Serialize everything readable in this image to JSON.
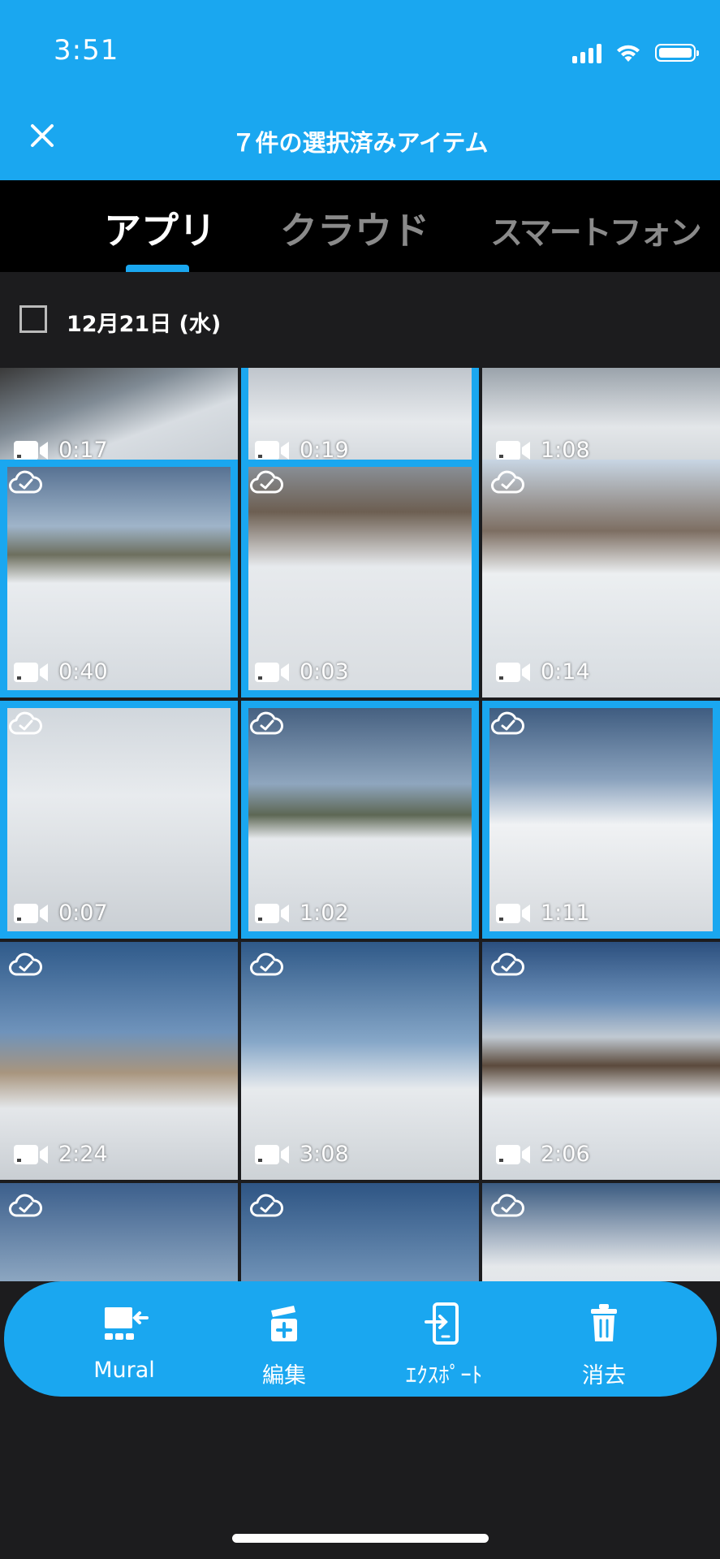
{
  "status_bar": {
    "time": "3:51"
  },
  "header": {
    "title": "７件の選択済みアイテム",
    "close_icon": "close-icon"
  },
  "tabs": [
    {
      "label": "アプリ",
      "active": true
    },
    {
      "label": "クラウド",
      "active": false
    },
    {
      "label": "スマートフォン",
      "active": false
    }
  ],
  "date_group": {
    "label": "12月21日 (水)",
    "checked": false
  },
  "tiles": [
    {
      "duration": "0:17",
      "selected": false,
      "cloud": false,
      "scene": "snow-1"
    },
    {
      "duration": "0:19",
      "selected": true,
      "cloud": false,
      "scene": "snow-2"
    },
    {
      "duration": "1:08",
      "selected": false,
      "cloud": false,
      "scene": "snow-3"
    },
    {
      "duration": "0:40",
      "selected": true,
      "cloud": true,
      "scene": "mountain"
    },
    {
      "duration": "0:03",
      "selected": true,
      "cloud": true,
      "scene": "snow-tree"
    },
    {
      "duration": "0:14",
      "selected": false,
      "cloud": true,
      "scene": "lift"
    },
    {
      "duration": "0:07",
      "selected": true,
      "cloud": true,
      "scene": "lift-2"
    },
    {
      "duration": "1:02",
      "selected": true,
      "cloud": true,
      "scene": "slope"
    },
    {
      "duration": "1:11",
      "selected": true,
      "cloud": true,
      "scene": "skiers"
    },
    {
      "duration": "2:24",
      "selected": false,
      "cloud": true,
      "scene": "swing-1"
    },
    {
      "duration": "3:08",
      "selected": false,
      "cloud": true,
      "scene": "swing-2"
    },
    {
      "duration": "2:06",
      "selected": false,
      "cloud": true,
      "scene": "mountain-2"
    },
    {
      "duration": "",
      "selected": false,
      "cloud": true,
      "scene": "swing-3"
    },
    {
      "duration": "",
      "selected": false,
      "cloud": true,
      "scene": "swing-4"
    },
    {
      "duration": "",
      "selected": false,
      "cloud": true,
      "scene": "snow-4"
    }
  ],
  "actions": [
    {
      "label": "Mural",
      "icon": "mural-icon"
    },
    {
      "label": "編集",
      "icon": "edit-icon"
    },
    {
      "label": "ｴｸｽﾎﾟｰﾄ",
      "icon": "export-icon"
    },
    {
      "label": "消去",
      "icon": "trash-icon"
    }
  ],
  "colors": {
    "accent": "#1aa7f0",
    "background": "#1c1c1e",
    "tab_bar": "#000000",
    "inactive_tab": "#8a8a8a"
  }
}
